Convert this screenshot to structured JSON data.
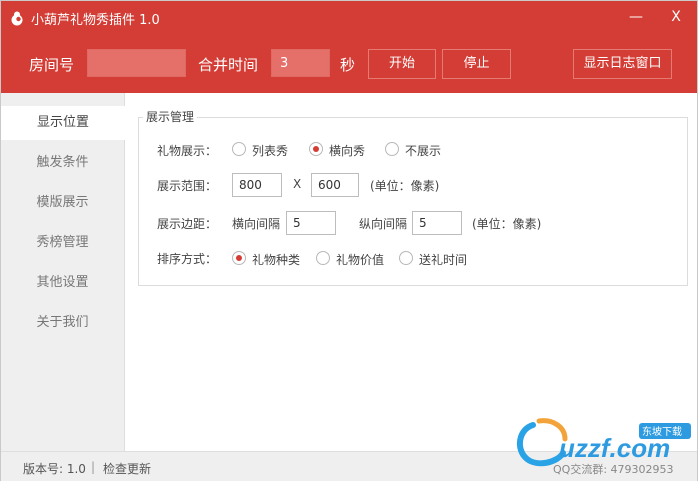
{
  "window": {
    "title": "小葫芦礼物秀插件 1.0",
    "minimize": "—",
    "close": "X"
  },
  "toolbar": {
    "room_label": "房间号",
    "room_value": "",
    "merge_label": "合并时间",
    "merge_value": "3",
    "seconds_label": "秒",
    "start_label": "开始",
    "stop_label": "停止",
    "log_label": "显示日志窗口"
  },
  "sidebar": {
    "items": [
      {
        "label": "显示位置",
        "active": true
      },
      {
        "label": "触发条件"
      },
      {
        "label": "模版展示"
      },
      {
        "label": "秀榜管理"
      },
      {
        "label": "其他设置"
      },
      {
        "label": "关于我们"
      }
    ]
  },
  "panel": {
    "group_title": "展示管理",
    "display": {
      "label": "礼物展示：",
      "options": [
        "列表秀",
        "横向秀",
        "不展示"
      ],
      "selected": "横向秀"
    },
    "range": {
      "label": "展示范围：",
      "width": "800",
      "x": "X",
      "height": "600",
      "unit": "(单位：像素)"
    },
    "margin": {
      "label": "展示边距：",
      "h_label": "横向间隔",
      "h_value": "5",
      "v_label": "纵向间隔",
      "v_value": "5",
      "unit": "(单位：像素)"
    },
    "sort": {
      "label": "排序方式：",
      "options": [
        "礼物种类",
        "礼物价值",
        "送礼时间"
      ],
      "selected": "礼物种类"
    }
  },
  "status": {
    "version": "版本号: 1.0",
    "separator": "|",
    "check_update": "检查更新"
  },
  "watermark": {
    "site": "uzzf.com",
    "badge": "东坡下载",
    "qq": "QQ交流群: 479302953"
  },
  "colors": {
    "accent": "#d43d35",
    "sidebar_bg": "#efefef"
  }
}
